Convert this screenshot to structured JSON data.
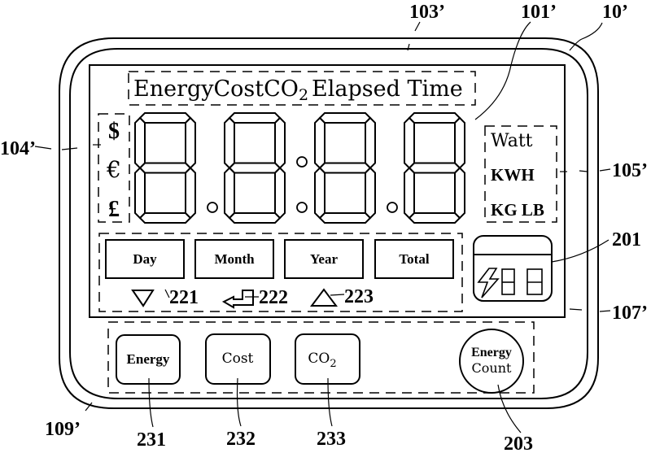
{
  "device": {
    "title_bar": {
      "prefix": "EnergyCostCO",
      "subscript": "2",
      "suffix": "Elapsed Time"
    },
    "currency_symbols": [
      "$",
      "€",
      "£"
    ],
    "display_digits": 4,
    "units": [
      "Watt",
      "KWH",
      "KG LB"
    ],
    "period_buttons": [
      "Day",
      "Month",
      "Year",
      "Total"
    ],
    "nav_icons": [
      {
        "icon": "down-triangle-icon",
        "ref": "221"
      },
      {
        "icon": "enter-arrow-icon",
        "ref": "222"
      },
      {
        "icon": "up-triangle-icon",
        "ref": "223"
      }
    ],
    "mini_display": {
      "icon": "lightning-bolt-icon",
      "digits": 2
    },
    "buttons": [
      {
        "label": "Energy",
        "ref": "231"
      },
      {
        "label": "Cost",
        "ref": "232"
      },
      {
        "label": "CO",
        "sub": "2",
        "ref": "233"
      }
    ],
    "round_button": {
      "line1": "Energy",
      "line2": "Count",
      "ref": "203"
    }
  },
  "reference_labels": {
    "r103": "103’",
    "r101": "101’",
    "r10": "10’",
    "r104": "104’",
    "r105": "105’",
    "r201": "201",
    "r107": "107’",
    "r109": "109’"
  }
}
